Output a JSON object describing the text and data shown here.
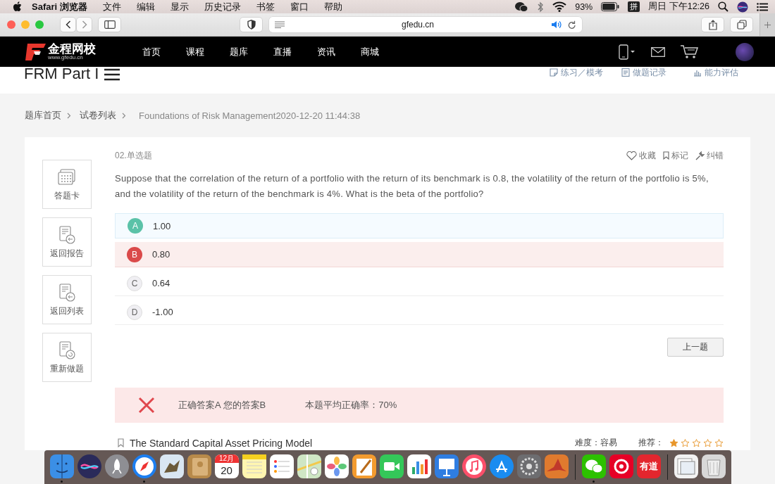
{
  "menu_bar": {
    "app": "Safari 浏览器",
    "menus": [
      "文件",
      "编辑",
      "显示",
      "历史记录",
      "书签",
      "窗口",
      "帮助"
    ],
    "battery": "93%",
    "input_method": "拼",
    "clock": "周日 下午12:26"
  },
  "browser": {
    "url": "gfedu.cn",
    "audio_playing": true
  },
  "site_header": {
    "logo_name": "金程网校",
    "logo_url": "www.gfedu.cn",
    "nav": [
      "首页",
      "课程",
      "题库",
      "直播",
      "资讯",
      "商城"
    ]
  },
  "subheader": {
    "title": "FRM Part I",
    "links": [
      {
        "label": "练习／模考",
        "kind": "practice"
      },
      {
        "label": "做题记录",
        "kind": "record"
      },
      {
        "label": "能力评估",
        "kind": "ability"
      }
    ]
  },
  "breadcrumb": [
    "题库首页",
    "试卷列表",
    "Foundations of Risk Management2020-12-20 11:44:38"
  ],
  "side_actions": [
    {
      "label": "答题卡",
      "kind": "card"
    },
    {
      "label": "返回报告",
      "kind": "report"
    },
    {
      "label": "返回列表",
      "kind": "list"
    },
    {
      "label": "重新做题",
      "kind": "redo"
    }
  ],
  "question": {
    "number": "02.单选题",
    "actions": [
      {
        "label": "收藏",
        "kind": "favorite"
      },
      {
        "label": "标记",
        "kind": "bookmark"
      },
      {
        "label": "纠错",
        "kind": "fix"
      }
    ],
    "text": "Suppose that the correlation of the return of a portfolio with the return of its benchmark is 0.8, the volatility of the return of the portfolio is 5%, and the volatility of the return of the benchmark is 4%. What is the beta of the portfolio?",
    "options": [
      {
        "letter": "A",
        "text": "1.00",
        "correct": true,
        "chosen": false
      },
      {
        "letter": "B",
        "text": "0.80",
        "correct": false,
        "chosen": true
      },
      {
        "letter": "C",
        "text": "0.64",
        "correct": false,
        "chosen": false
      },
      {
        "letter": "D",
        "text": "-1.00",
        "correct": false,
        "chosen": false
      }
    ],
    "prev_button": "上一题"
  },
  "result": {
    "correct": false,
    "answers": "正确答案A 您的答案B",
    "average": "本题平均正确率：70%"
  },
  "topic": {
    "title": "The Standard Capital Asset Pricing Model",
    "difficulty": "难度：容易",
    "recommend_label": "推荐：",
    "stars": 1
  },
  "dock": [
    {
      "kind": "finder",
      "running": true
    },
    {
      "kind": "siri",
      "running": false
    },
    {
      "kind": "launchpad",
      "running": false
    },
    {
      "kind": "safari",
      "running": true
    },
    {
      "kind": "mail",
      "running": false
    },
    {
      "kind": "contacts",
      "running": false
    },
    {
      "kind": "calendar",
      "running": false,
      "month": "12月",
      "day": "20"
    },
    {
      "kind": "notes",
      "running": false
    },
    {
      "kind": "reminders",
      "running": false
    },
    {
      "kind": "maps",
      "running": false
    },
    {
      "kind": "photos",
      "running": false
    },
    {
      "kind": "pages",
      "running": false
    },
    {
      "kind": "facetime",
      "running": false
    },
    {
      "kind": "numbers",
      "running": false
    },
    {
      "kind": "keynote",
      "running": false
    },
    {
      "kind": "music",
      "running": false
    },
    {
      "kind": "appstore",
      "running": false
    },
    {
      "kind": "settings",
      "running": false
    },
    {
      "kind": "matlab",
      "running": false
    },
    {
      "kind": "separator"
    },
    {
      "kind": "wechat",
      "running": true
    },
    {
      "kind": "netease",
      "running": false
    },
    {
      "kind": "youdao",
      "running": false,
      "label": "有道"
    },
    {
      "kind": "separator"
    },
    {
      "kind": "preview",
      "running": false
    },
    {
      "kind": "trash",
      "running": false
    }
  ]
}
